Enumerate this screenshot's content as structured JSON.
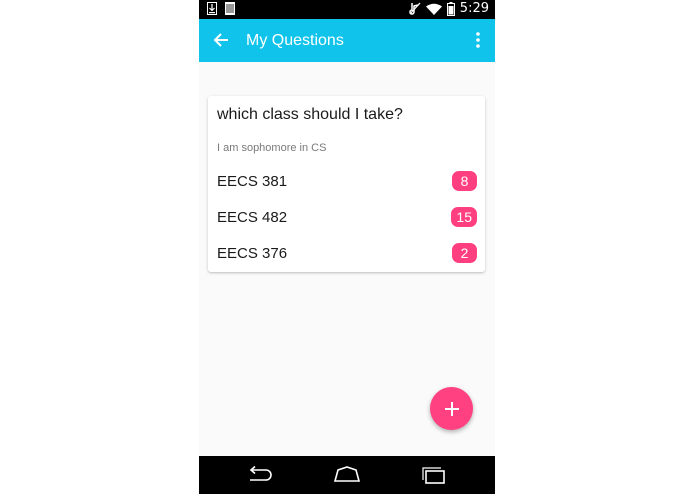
{
  "status_bar": {
    "time": "5:29",
    "icons": [
      "download-icon",
      "sim-card-icon",
      "no-sound-icon",
      "wifi-icon",
      "battery-icon"
    ]
  },
  "app_bar": {
    "title": "My Questions",
    "background_color": "#10c3eb",
    "icons": [
      "arrow-back-icon",
      "more-vert-icon"
    ]
  },
  "question": {
    "title": "which class should I take?",
    "description": "I am sophomore in CS",
    "options": [
      {
        "label": "EECS 381",
        "votes": "8"
      },
      {
        "label": "EECS 482",
        "votes": "15"
      },
      {
        "label": "EECS 376",
        "votes": "2"
      }
    ],
    "badge_color": "#ff3f80"
  },
  "fab": {
    "icon": "plus-icon",
    "color": "#ff4081"
  },
  "nav_bar": {
    "icons": [
      "back-nav-icon",
      "home-nav-icon",
      "recent-apps-icon"
    ]
  }
}
